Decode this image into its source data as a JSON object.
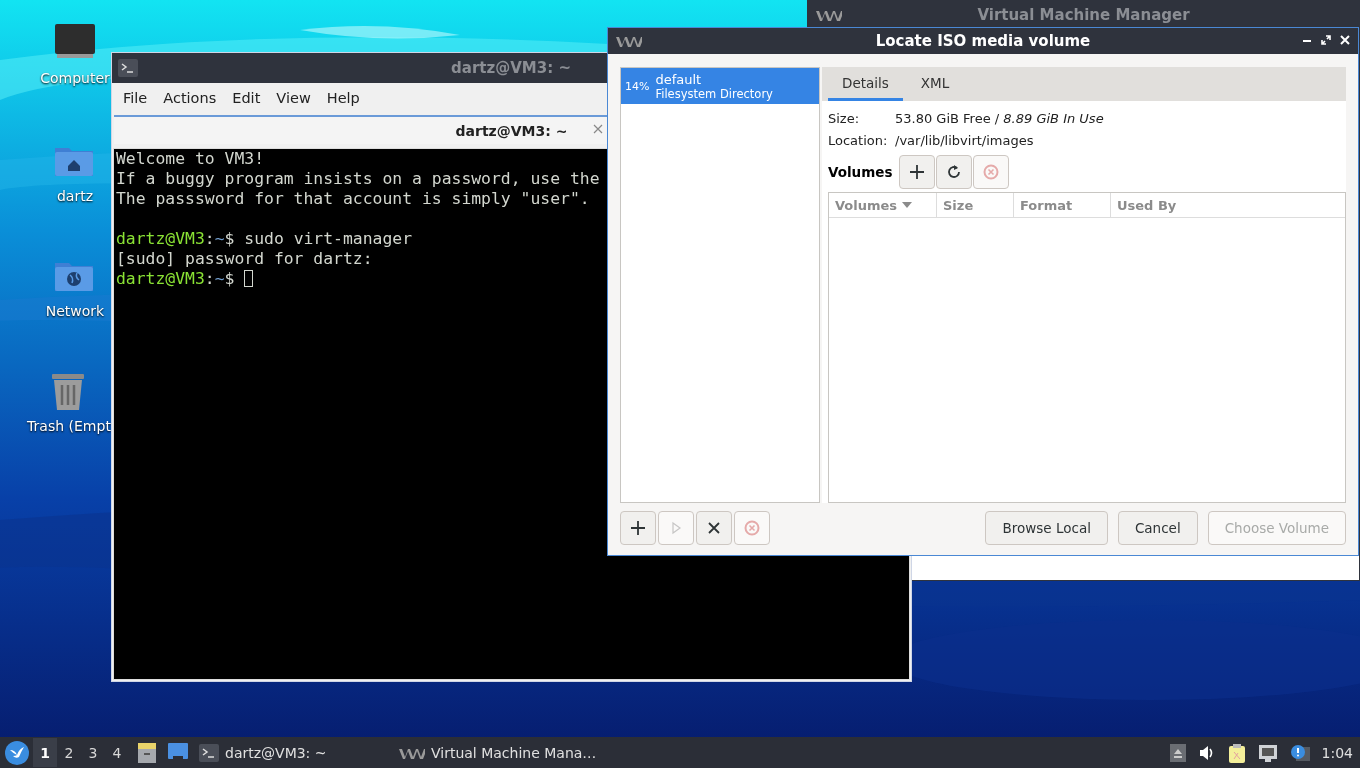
{
  "desktop": {
    "icons": [
      {
        "kind": "computer",
        "label": "Computer"
      },
      {
        "kind": "home",
        "label": "dartz"
      },
      {
        "kind": "network",
        "label": "Network"
      },
      {
        "kind": "trash",
        "label": "Trash (Empt"
      }
    ]
  },
  "vmm_window": {
    "title": "Virtual Machine Manager"
  },
  "terminal_window": {
    "title": "dartz@VM3: ~",
    "menu": [
      "File",
      "Actions",
      "Edit",
      "View",
      "Help"
    ],
    "tab": {
      "title": "dartz@VM3: ~"
    },
    "lines": [
      {
        "kind": "text",
        "text": "Welcome to VM3!"
      },
      {
        "kind": "text",
        "text": "If a buggy program insists on a password, use the"
      },
      {
        "kind": "text",
        "text": "The passsword for that account is simply \"user\"."
      },
      {
        "kind": "blank"
      },
      {
        "kind": "prompt",
        "user": "dartz@VM3",
        "colon": ":",
        "path": "~",
        "rest": "$ sudo virt-manager",
        "cursor": false
      },
      {
        "kind": "text",
        "text": "[sudo] password for dartz:"
      },
      {
        "kind": "prompt",
        "user": "dartz@VM3",
        "colon": ":",
        "path": "~",
        "rest": "$",
        "cursor": true
      }
    ]
  },
  "dialog": {
    "title": "Locate ISO media volume",
    "pools": [
      {
        "percent": "14%",
        "name": "default",
        "type": "Filesystem Directory",
        "selected": true
      }
    ],
    "tabs": [
      {
        "label": "Details",
        "selected": true
      },
      {
        "label": "XML",
        "selected": false
      }
    ],
    "details": [
      {
        "label": "Size:",
        "value": "53.80 GiB Free / *8.89 GiB In Use*"
      },
      {
        "label": "Location:",
        "value": "/var/lib/libvirt/images"
      }
    ],
    "volumes_label": "Volumes",
    "volume_buttons": [
      {
        "kind": "add",
        "disabled": false
      },
      {
        "kind": "refresh",
        "disabled": false
      },
      {
        "kind": "delete",
        "disabled": true
      }
    ],
    "columns": [
      {
        "label": "Volumes",
        "sorted": true
      },
      {
        "label": "Size",
        "sorted": false
      },
      {
        "label": "Format",
        "sorted": false
      },
      {
        "label": "Used By",
        "sorted": false
      }
    ],
    "pool_buttons": [
      {
        "kind": "add",
        "disabled": false
      },
      {
        "kind": "start",
        "disabled": true
      },
      {
        "kind": "stop",
        "disabled": false
      },
      {
        "kind": "delete",
        "disabled": true
      }
    ],
    "buttons": [
      {
        "label": "Browse Local",
        "disabled": false
      },
      {
        "label": "Cancel",
        "disabled": false
      },
      {
        "label": "Choose Volume",
        "disabled": true
      }
    ]
  },
  "taskbar": {
    "workspaces": [
      {
        "label": "1",
        "selected": true
      },
      {
        "label": "2",
        "selected": false
      },
      {
        "label": "3",
        "selected": false
      },
      {
        "label": "4",
        "selected": false
      }
    ],
    "tasks": [
      {
        "kind": "terminal",
        "title": "dartz@VM3: ~"
      },
      {
        "kind": "vmm",
        "title": "Virtual Machine Mana…"
      }
    ],
    "clock": "1:04"
  }
}
